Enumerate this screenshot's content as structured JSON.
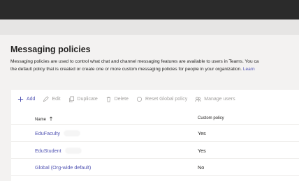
{
  "page": {
    "title": "Messaging policies",
    "description_line1": "Messaging policies are used to control what chat and channel messaging features are available to users in Teams. You ca",
    "description_line2_text": "the default policy that is created or create one or more custom messaging policies for people in your organization. ",
    "description_line2_link": "Learn"
  },
  "toolbar": {
    "items": [
      {
        "label": "Add",
        "icon": "plus-icon",
        "enabled": true
      },
      {
        "label": "Edit",
        "icon": "pencil-icon",
        "enabled": false
      },
      {
        "label": "Duplicate",
        "icon": "copy-icon",
        "enabled": false
      },
      {
        "label": "Delete",
        "icon": "trash-icon",
        "enabled": false
      },
      {
        "label": "Reset Global policy",
        "icon": "reset-icon",
        "enabled": false
      },
      {
        "label": "Manage users",
        "icon": "users-icon",
        "enabled": false
      }
    ]
  },
  "table": {
    "columns": {
      "name": "Name",
      "custom": "Custom policy"
    },
    "rows": [
      {
        "name": "EduFaculty",
        "custom": "Yes"
      },
      {
        "name": "EduStudent",
        "custom": "Yes"
      },
      {
        "name": "Global (Org-wide default)",
        "custom": "No"
      }
    ]
  },
  "colors": {
    "accent": "#4f52b2",
    "topbar": "#2b2b2b",
    "background": "#f3f2f1"
  }
}
